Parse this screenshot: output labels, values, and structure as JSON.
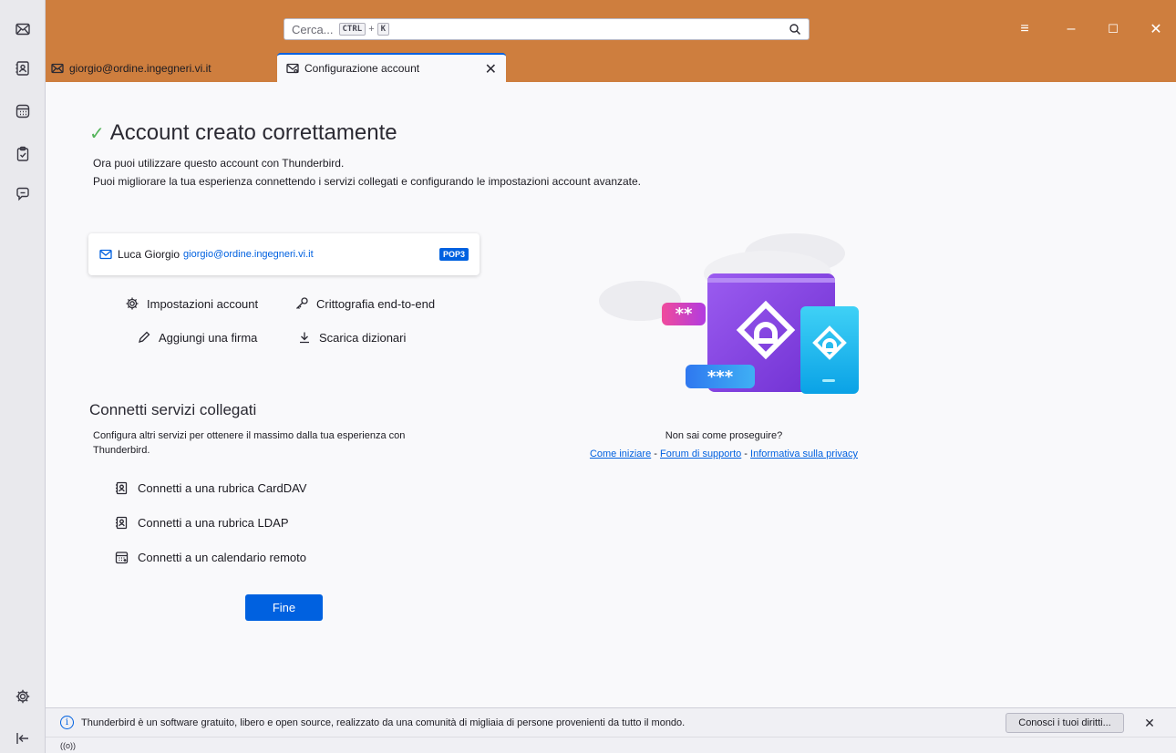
{
  "search": {
    "placeholder": "Cerca...",
    "key1": "CTRL",
    "plus": "+",
    "key2": "K"
  },
  "tabs": [
    {
      "label": "giorgio@ordine.ingegneri.vi.it"
    },
    {
      "label": "Configurazione account"
    }
  ],
  "page": {
    "title": "Account creato correttamente",
    "subtitle_1": "Ora puoi utilizzare questo account con Thunderbird.",
    "subtitle_2": "Puoi migliorare la tua esperienza connettendo i servizi collegati e configurando le impostazioni account avanzate."
  },
  "account": {
    "name": "Luca Giorgio",
    "email": "giorgio@ordine.ingegneri.vi.it",
    "type": "POP3"
  },
  "actions": {
    "settings": "Impostazioni account",
    "e2e": "Crittografia end-to-end",
    "signature": "Aggiungi una firma",
    "dictionaries": "Scarica dizionari"
  },
  "services": {
    "title": "Connetti servizi collegati",
    "description": "Configura altri servizi per ottenere il massimo dalla tua esperienza con Thunderbird.",
    "items": [
      {
        "label": "Connetti a una rubrica CardDAV"
      },
      {
        "label": "Connetti a una rubrica LDAP"
      },
      {
        "label": "Connetti a un calendario remoto"
      }
    ]
  },
  "finish_label": "Fine",
  "help": {
    "question": "Non sai come proseguire?",
    "link1": "Come iniziare",
    "sep": " - ",
    "link2": "Forum di supporto",
    "link3": "Informativa sulla privacy"
  },
  "illustration": {
    "pw1": "**",
    "pw2": "***"
  },
  "notification": {
    "text": "Thunderbird è un software gratuito, libero e open source, realizzato da una comunità di migliaia di persone provenienti da tutto il mondo.",
    "button": "Conosci i tuoi diritti...",
    "close": "✕"
  },
  "status": {
    "activity": "((o))"
  },
  "window_controls": {
    "menu": "≡",
    "minimize": "–",
    "maximize": "☐",
    "close": "✕"
  },
  "colors": {
    "titlebar": "#ce7e3e",
    "accent": "#0061e0",
    "success": "#54b45a"
  }
}
